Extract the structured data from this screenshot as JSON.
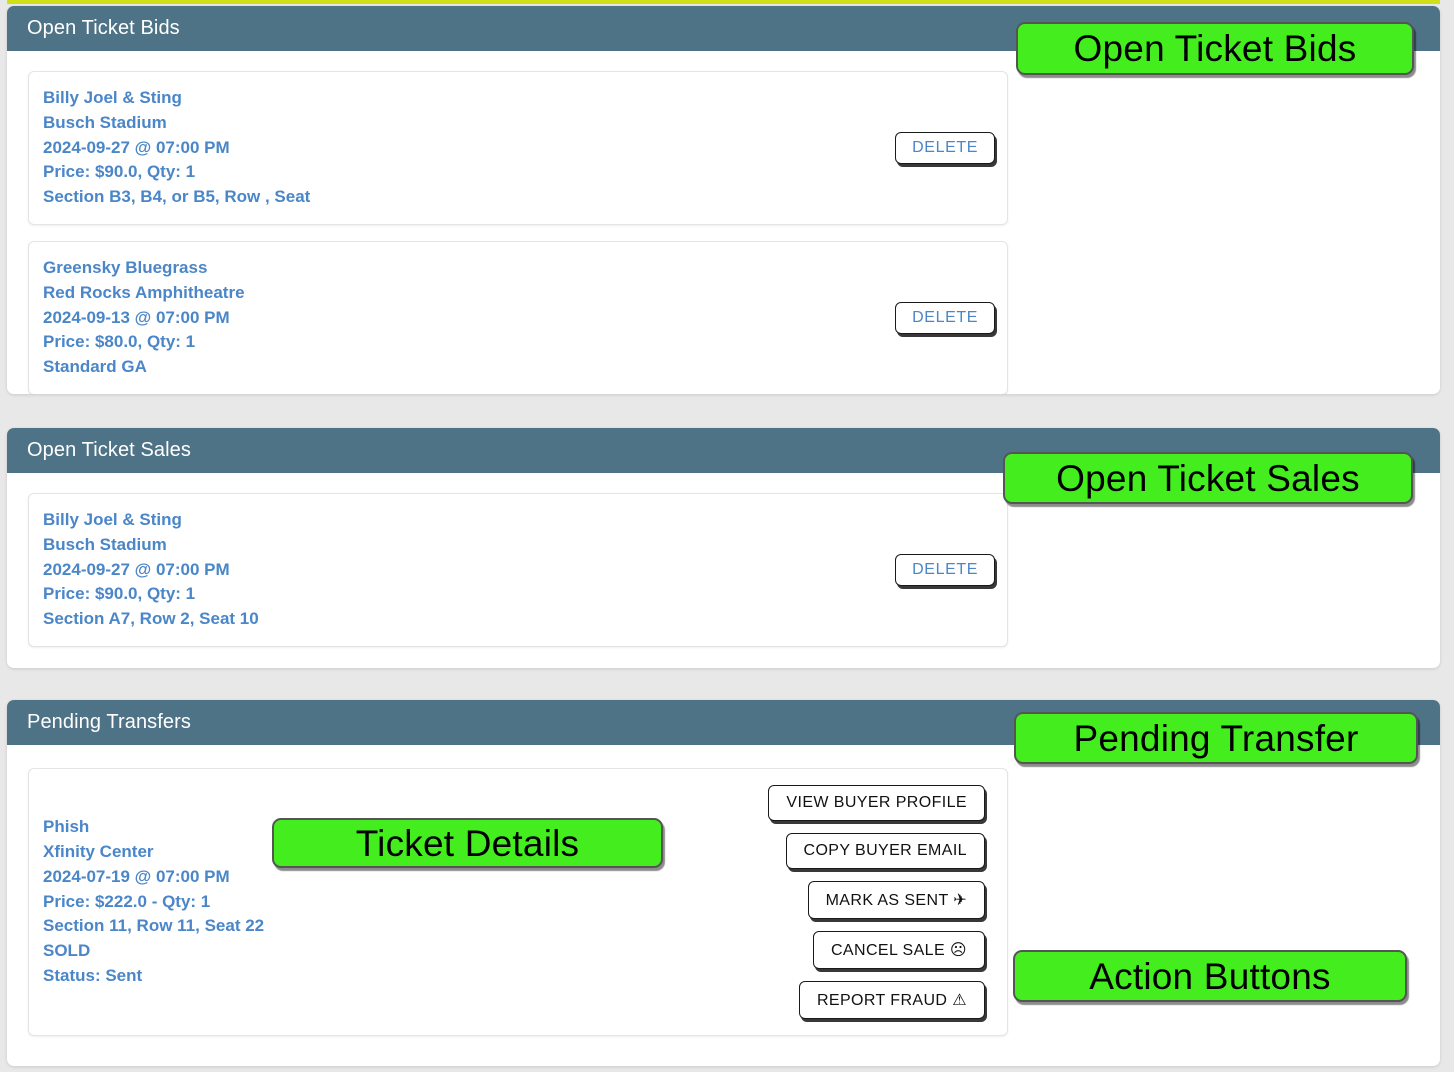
{
  "theme": {
    "header_bg": "#4f7386",
    "page_bg": "#e8e8e8",
    "card_bg": "#ffffff",
    "link_blue": "#4a86c8",
    "annotation_green": "#44ee1e",
    "accent_strip": "#cfe016"
  },
  "sections": [
    {
      "id": "open-ticket-bids",
      "title": "Open Ticket Bids",
      "tickets": [
        {
          "event": "Billy Joel & Sting",
          "venue": "Busch Stadium",
          "datetime": "2024-09-27 @ 07:00 PM",
          "price_qty": "Price: $90.0, Qty: 1",
          "seat": "Section B3, B4, or B5, Row , Seat",
          "action_label": "DELETE"
        },
        {
          "event": "Greensky Bluegrass",
          "venue": "Red Rocks Amphitheatre",
          "datetime": "2024-09-13 @ 07:00 PM",
          "price_qty": "Price: $80.0, Qty: 1",
          "seat": "Standard GA",
          "action_label": "DELETE"
        }
      ]
    },
    {
      "id": "open-ticket-sales",
      "title": "Open Ticket Sales",
      "tickets": [
        {
          "event": "Billy Joel & Sting",
          "venue": "Busch Stadium",
          "datetime": "2024-09-27 @ 07:00 PM",
          "price_qty": "Price: $90.0, Qty: 1",
          "seat": "Section A7, Row 2, Seat 10",
          "action_label": "DELETE"
        }
      ]
    },
    {
      "id": "pending-transfers",
      "title": "Pending Transfers",
      "tickets": [
        {
          "event": "Phish",
          "venue": "Xfinity Center",
          "datetime": "2024-07-19 @ 07:00 PM",
          "price_qty": "Price: $222.0 - Qty: 1",
          "seat": "Section 11, Row 11, Seat 22",
          "sold": "SOLD",
          "status": "Status: Sent"
        }
      ],
      "action_buttons": [
        {
          "label": "VIEW BUYER PROFILE",
          "icon": ""
        },
        {
          "label": "COPY BUYER EMAIL",
          "icon": ""
        },
        {
          "label": "MARK AS SENT",
          "icon": "✈"
        },
        {
          "label": "CANCEL SALE",
          "icon": "☹"
        },
        {
          "label": "REPORT FRAUD",
          "icon": "⚠"
        }
      ]
    }
  ],
  "annotations": [
    {
      "id": "anno-open-ticket-bids",
      "text": "Open Ticket Bids"
    },
    {
      "id": "anno-open-ticket-sales",
      "text": "Open Ticket Sales"
    },
    {
      "id": "anno-pending-transfer",
      "text": "Pending Transfer"
    },
    {
      "id": "anno-ticket-details",
      "text": "Ticket Details"
    },
    {
      "id": "anno-action-buttons",
      "text": "Action Buttons"
    }
  ]
}
